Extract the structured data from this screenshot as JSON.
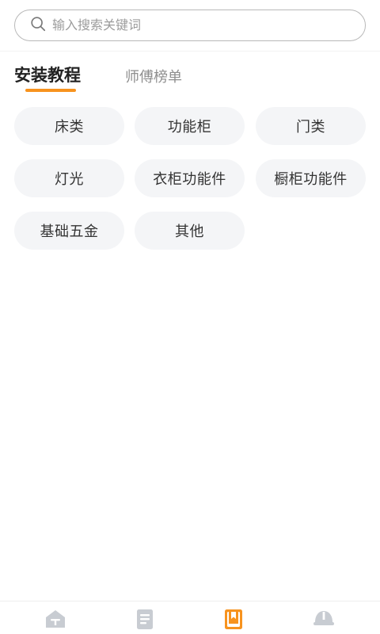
{
  "search": {
    "placeholder": "输入搜索关键词",
    "icon": "search-icon"
  },
  "tabs": [
    {
      "label": "安装教程",
      "active": true
    },
    {
      "label": "师傅榜单",
      "active": false
    }
  ],
  "categories": [
    "床类",
    "功能柜",
    "门类",
    "灯光",
    "衣柜功能件",
    "橱柜功能件",
    "基础五金",
    "其他"
  ],
  "bottom_nav": [
    {
      "icon": "home-icon",
      "active": false
    },
    {
      "icon": "document-icon",
      "active": false
    },
    {
      "icon": "book-icon",
      "active": true
    },
    {
      "icon": "helmet-icon",
      "active": false
    }
  ],
  "colors": {
    "accent": "#f7931e",
    "inactive_icon": "#c8ccd2",
    "chip_bg": "#f4f5f7"
  }
}
